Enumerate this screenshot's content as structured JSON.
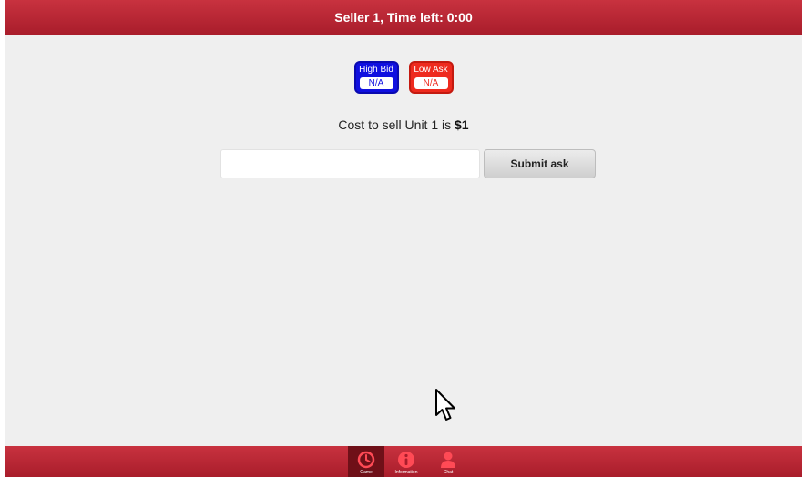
{
  "header": {
    "title": "Seller 1, Time left: 0:00"
  },
  "badges": {
    "high_bid_label": "High Bid",
    "high_bid_value": "N/A",
    "low_ask_label": "Low Ask",
    "low_ask_value": "N/A"
  },
  "cost": {
    "prefix": "Cost to sell Unit 1 is ",
    "amount": "$1"
  },
  "ask_form": {
    "input_value": "",
    "submit_label": "Submit ask"
  },
  "footer_nav": {
    "items": [
      {
        "label": "Game",
        "icon": "clock-icon",
        "active": true
      },
      {
        "label": "Information",
        "icon": "info-icon",
        "active": false
      },
      {
        "label": "Chat",
        "icon": "person-icon",
        "active": false
      }
    ]
  },
  "colors": {
    "header_red": "#b42633",
    "high_bid_blue": "#1010e0",
    "low_ask_red": "#ee2a1e"
  }
}
